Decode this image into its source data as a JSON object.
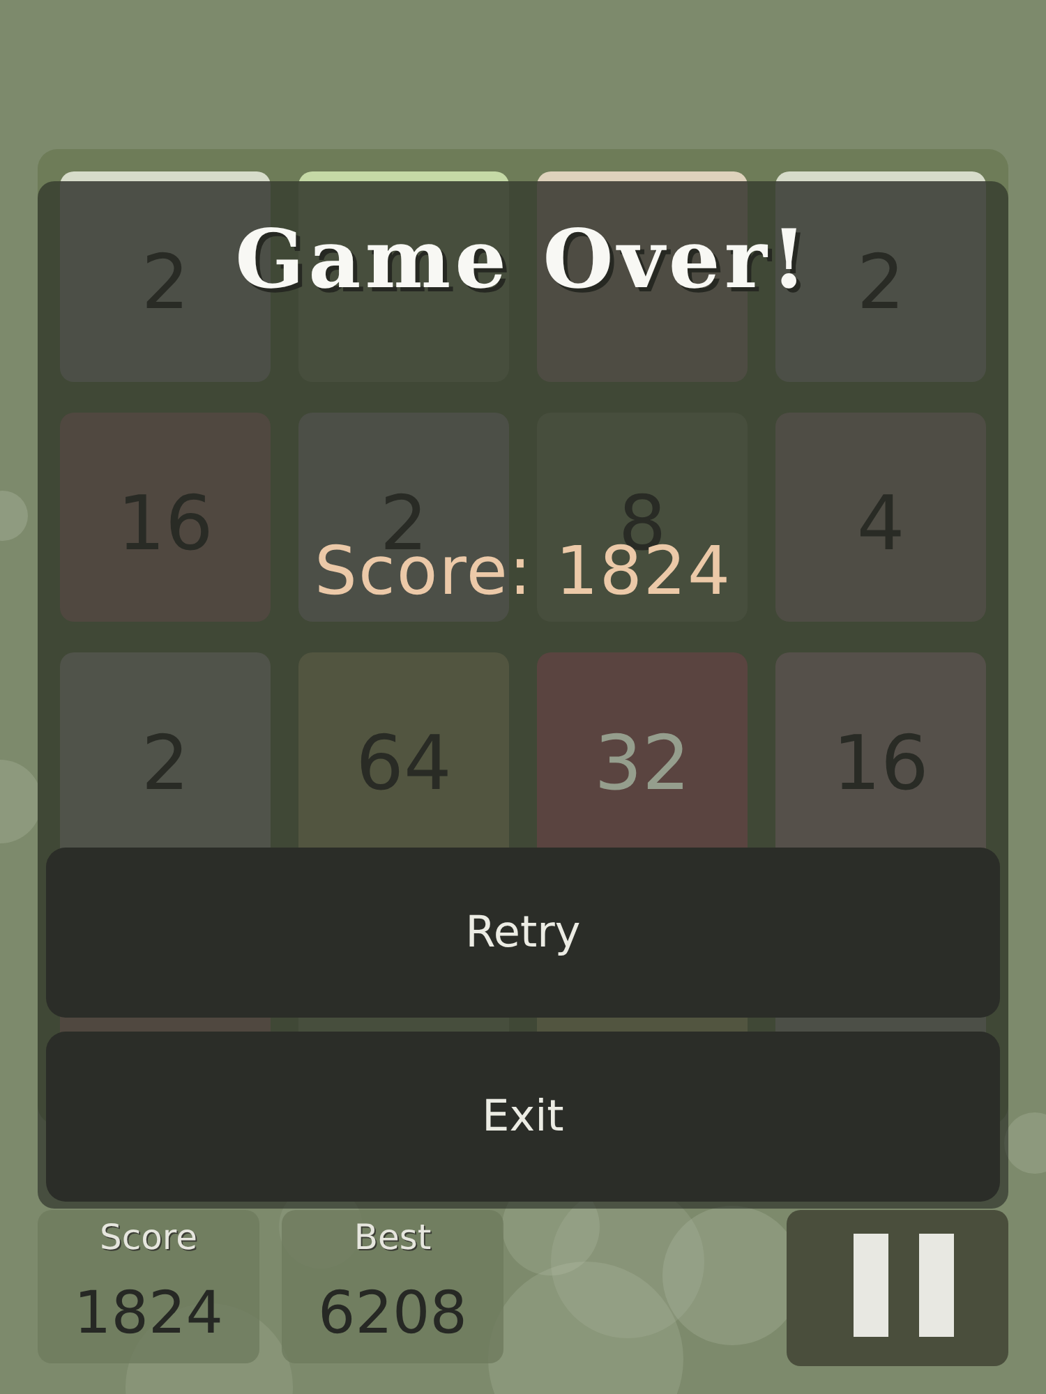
{
  "board": {
    "tiles": [
      [
        {
          "value": "2",
          "color": "#4c4f47",
          "light_text": false
        },
        {
          "color": "#474e3d"
        },
        {
          "color": "#4e4c43"
        },
        {
          "value": "2",
          "color": "#4c4f47",
          "light_text": false
        }
      ],
      [
        {
          "value": "16",
          "color": "#504840",
          "light_text": false
        },
        {
          "value": "2",
          "color": "#4c4f47",
          "light_text": false
        },
        {
          "value": "8",
          "color": "#474e3d",
          "light_text": false
        },
        {
          "value": "4",
          "color": "#4f4d45",
          "light_text": false
        }
      ],
      [
        {
          "value": "2",
          "color": "#50534a",
          "light_text": false
        },
        {
          "value": "64",
          "color": "#525540",
          "light_text": false
        },
        {
          "value": "32",
          "color": "#5a4440",
          "light_text": true
        },
        {
          "value": "16",
          "color": "#55504a",
          "light_text": false
        }
      ],
      [
        {
          "color": "#504840"
        },
        {
          "color": "#474e3d"
        },
        {
          "color": "#525540"
        },
        {
          "color": "#4c4f47"
        }
      ]
    ]
  },
  "overlay": {
    "title": "Game Over!",
    "score_text": "Score: 1824",
    "buttons": [
      "Retry",
      "Exit"
    ]
  },
  "stats": [
    {
      "label": "Score",
      "value": "1824"
    },
    {
      "label": "Best",
      "value": "6208"
    }
  ]
}
